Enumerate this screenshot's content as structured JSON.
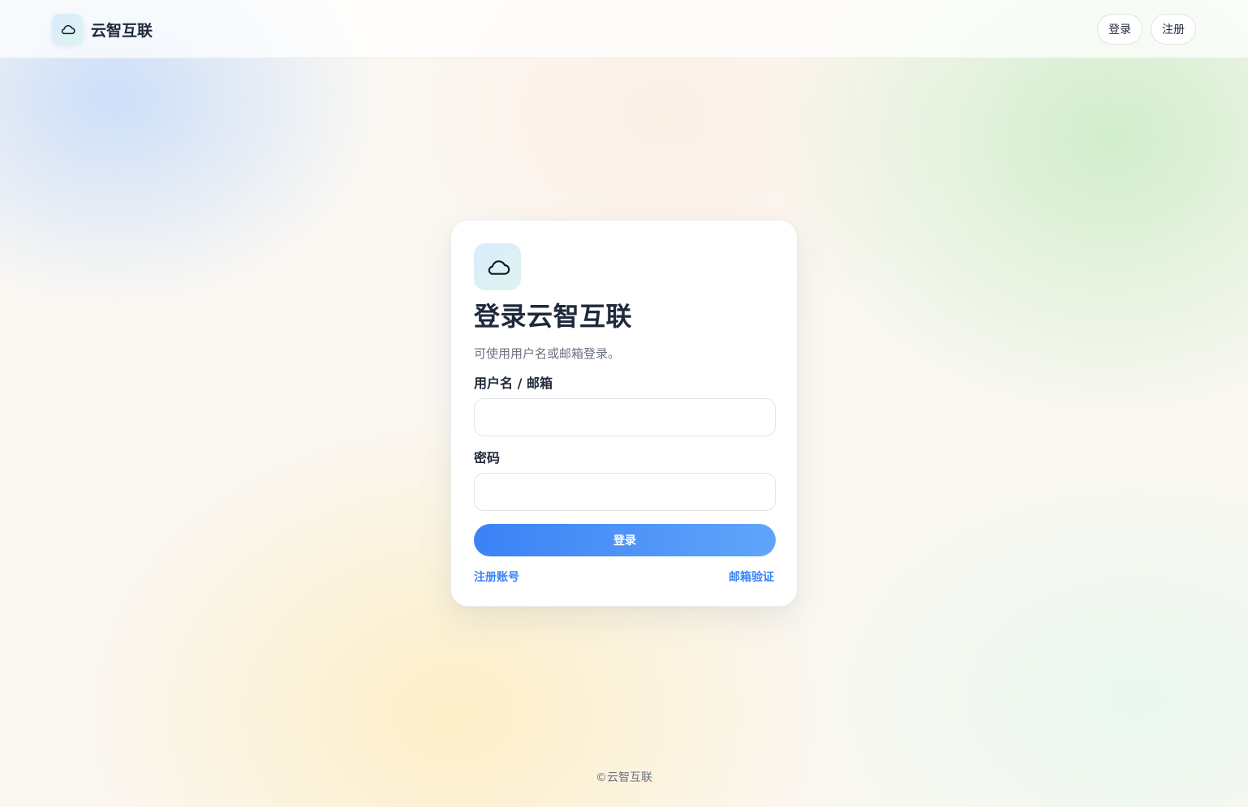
{
  "header": {
    "brand_name": "云智互联",
    "logo_icon": "cloud-icon",
    "nav": {
      "login_label": "登录",
      "register_label": "注册"
    }
  },
  "login_card": {
    "logo_icon": "cloud-icon",
    "title": "登录云智互联",
    "subtitle": "可使用用户名或邮箱登录。",
    "username_label": "用户名 / 邮箱",
    "username_value": "",
    "password_label": "密码",
    "password_value": "",
    "submit_label": "登录",
    "register_link": "注册账号",
    "email_verify_link": "邮箱验证"
  },
  "footer": {
    "copyright": "©云智互联"
  },
  "colors": {
    "accent": "#3b82f6",
    "accent_light": "#60a5fa",
    "title_text": "#1e293b",
    "muted_text": "#6b7280"
  }
}
